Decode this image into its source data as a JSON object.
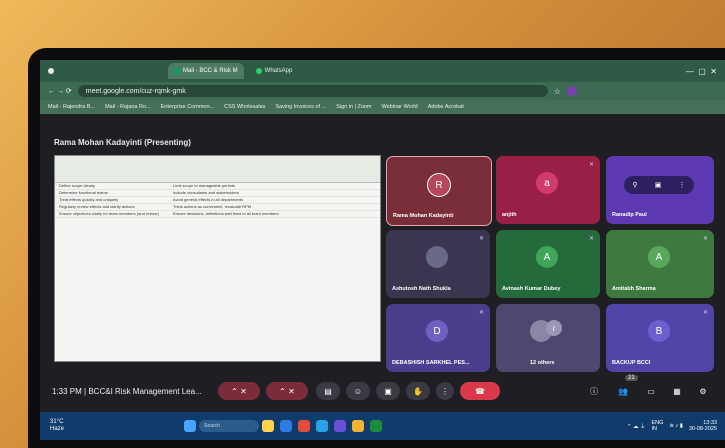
{
  "browser": {
    "tabs": [
      {
        "label": "Mail - BCC & Risk M",
        "active": true
      },
      {
        "label": "WhatsApp",
        "active": false
      }
    ],
    "url": "meet.google.com/cuz-rqmk-gmk",
    "bookmarks": [
      "Mail - Rajendra B...",
      "Mail - Rajana Ro...",
      "Enterprise Common...",
      "CSS Wholesales",
      "Saving Invoices of ...",
      "Sign in | Zoom",
      "Webinar World",
      "Adobe Acrobat"
    ]
  },
  "presenting_title": "Rama Mohan Kadayinti (Presenting)",
  "sheet_rows": [
    [
      "Define scope clearly",
      "Limit scope to manageable periods"
    ],
    [
      "Determine functional teams",
      "Include consultants and stakeholders"
    ],
    [
      "Treat effects quickly and uniquely",
      "Avoid general effects in all departments"
    ],
    [
      "Regularly review effects and clarify actions",
      "Think actions as convenient, revaluate RPM"
    ],
    [
      "Ensure objectives clarify for team members (and review)",
      "Ensure decisions, definitions well fixed to all team members"
    ]
  ],
  "participants": [
    {
      "name": "Rama Mohan Kadayinti",
      "initial": "R",
      "color": "#7a2e3a",
      "avatar": "#b5475a"
    },
    {
      "name": "anjith",
      "initial": "a",
      "color": "#9a1f47",
      "avatar": "#d23c6c"
    },
    {
      "name": "Ranadip Paul",
      "initial": "",
      "color": "#5d3ab3",
      "avatar": ""
    },
    {
      "name": "Ashutosh Nath Shukla",
      "initial": "",
      "color": "#3b3550",
      "avatar": "#6a6a86"
    },
    {
      "name": "Avinash Kumar Dubey",
      "initial": "A",
      "color": "#246a3a",
      "avatar": "#3fa559"
    },
    {
      "name": "Amitabh Sharma",
      "initial": "A",
      "color": "#3e7a40",
      "avatar": "#58a85c"
    },
    {
      "name": "DEBASHISH SARKHEL PES...",
      "initial": "D",
      "color": "#4a3f8c",
      "avatar": "#7060c2"
    },
    {
      "name": "12 others",
      "initial": "r",
      "color": "#4d4870",
      "avatar": "#8a86a6"
    },
    {
      "name": "BACKUP BCCI",
      "initial": "B",
      "color": "#5145a8",
      "avatar": "#6c5fcf"
    }
  ],
  "meeting": {
    "time": "1:33 PM",
    "separator": "|",
    "title": "BCC&I Risk Management Lea...",
    "participant_count": "21"
  },
  "taskbar": {
    "weather_temp": "31°C",
    "weather_desc": "Haze",
    "search_label": "Search",
    "lang": "ENG",
    "region": "IN",
    "clock_time": "13:33",
    "clock_date": "30-08-2025"
  }
}
